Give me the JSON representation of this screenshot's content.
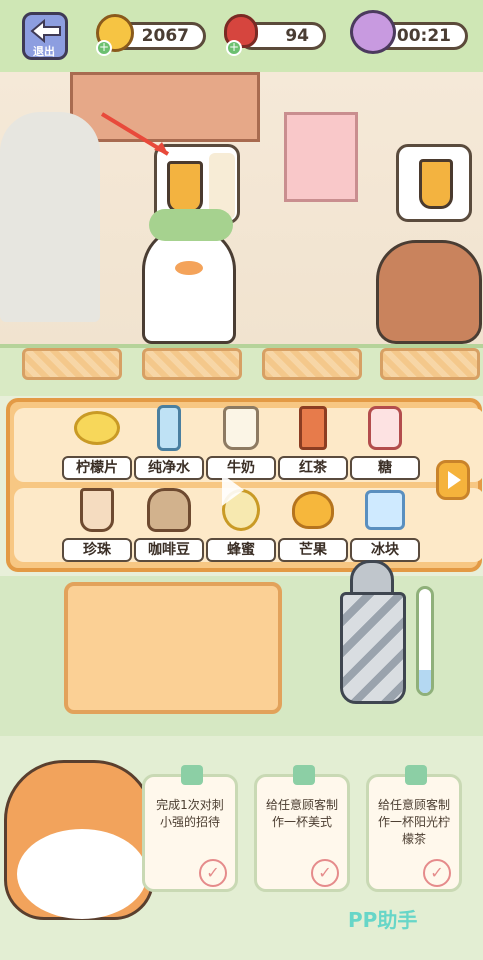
{
  "header": {
    "exit_label": "退出",
    "coins": "2067",
    "meat": "94",
    "timer": "00:21"
  },
  "ingredients": {
    "row1": [
      {
        "name": "柠檬片",
        "icon": "lemon-slice-icon"
      },
      {
        "name": "纯净水",
        "icon": "water-bottle-icon"
      },
      {
        "name": "牛奶",
        "icon": "milk-jug-icon"
      },
      {
        "name": "红茶",
        "icon": "black-tea-icon"
      },
      {
        "name": "糖",
        "icon": "sugar-jar-icon"
      }
    ],
    "row2": [
      {
        "name": "珍珠",
        "icon": "pearl-cup-icon"
      },
      {
        "name": "咖啡豆",
        "icon": "coffee-bean-sack-icon"
      },
      {
        "name": "蜂蜜",
        "icon": "honey-icon"
      },
      {
        "name": "芒果",
        "icon": "mango-icon"
      },
      {
        "name": "冰块",
        "icon": "ice-cube-icon"
      }
    ]
  },
  "tasks": [
    {
      "text": "完成1次对刺小强的招待"
    },
    {
      "text": "给任意顾客制作一杯美式"
    },
    {
      "text": "给任意顾客制作一杯阳光柠檬茶"
    }
  ],
  "watermark": "PP助手",
  "colors": {
    "accent": "#f5b33c",
    "panel": "#f7c783",
    "bg": "#d6e8c3"
  }
}
